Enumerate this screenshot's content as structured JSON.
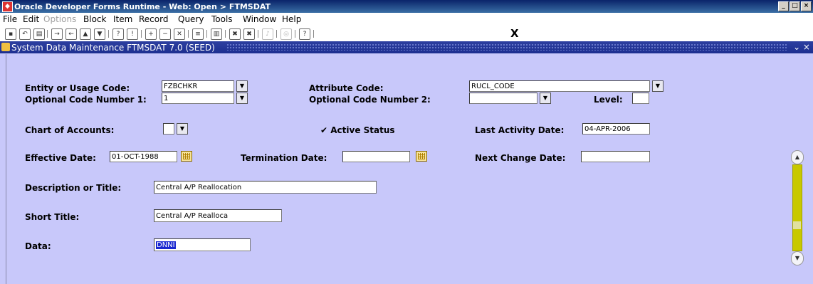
{
  "window": {
    "title": "Oracle Developer Forms Runtime - Web:  Open > FTMSDAT",
    "controls": [
      "_",
      "□",
      "×"
    ]
  },
  "menu": [
    "File",
    "Edit",
    "Options",
    "Block",
    "Item",
    "Record",
    "Query",
    "Tools",
    "Window",
    "Help"
  ],
  "toolbar": {
    "exit_label": "X"
  },
  "form": {
    "title": "System Data Maintenance  FTMSDAT  7.0  (SEED)",
    "controls": "⌄ ×"
  },
  "fields": {
    "entity_label": "Entity or Usage Code:",
    "entity_value": "FZBCHKR",
    "attribute_label": "Attribute Code:",
    "attribute_value": "RUCL_CODE",
    "opt1_label": "Optional Code Number 1:",
    "opt1_value": "1",
    "opt2_label": "Optional Code Number 2:",
    "opt2_value": "",
    "level_label": "Level:",
    "level_value": "",
    "coa_label": "Chart of Accounts:",
    "coa_value": "",
    "active_label": "Active Status",
    "active_checked": true,
    "last_activity_label": "Last Activity Date:",
    "last_activity_value": "04-APR-2006",
    "effective_label": "Effective Date:",
    "effective_value": "01-OCT-1988",
    "termination_label": "Termination Date:",
    "termination_value": "",
    "next_change_label": "Next Change Date:",
    "next_change_value": "",
    "description_label": "Description or Title:",
    "description_value": "Central A/P Reallocation",
    "short_title_label": "Short Title:",
    "short_title_value": "Central A/P Realloca",
    "data_label": "Data:",
    "data_value": "DNNI"
  }
}
